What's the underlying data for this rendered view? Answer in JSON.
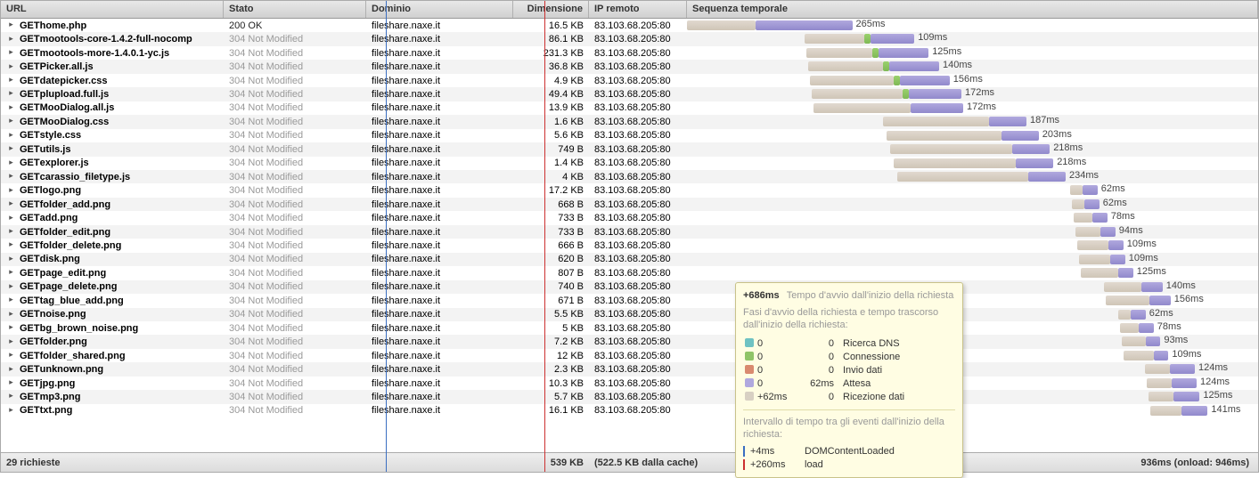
{
  "columns": {
    "url": "URL",
    "stato": "Stato",
    "dominio": "Dominio",
    "dimensione": "Dimensione",
    "ip": "IP remoto",
    "sequenza": "Sequenza temporale"
  },
  "rows": [
    {
      "method": "GET",
      "file": "home.php",
      "stato": "200 OK",
      "statoClass": "",
      "dominio": "fileshare.naxe.it",
      "dim": "16.5 KB",
      "ip": "83.103.68.205:80",
      "start": 0,
      "wait": 110,
      "dns": 0,
      "recv": 155,
      "label": "265ms"
    },
    {
      "method": "GET",
      "file": "mootools-core-1.4.2-full-nocomp",
      "stato": "304 Not Modified",
      "statoClass": "stato-notmod",
      "dominio": "fileshare.naxe.it",
      "dim": "86.1 KB",
      "ip": "83.103.68.205:80",
      "start": 132,
      "wait": 96,
      "dns": 10,
      "recv": 70,
      "label": "109ms"
    },
    {
      "method": "GET",
      "file": "mootools-more-1.4.0.1-yc.js",
      "stato": "304 Not Modified",
      "statoClass": "stato-notmod",
      "dominio": "fileshare.naxe.it",
      "dim": "231.3 KB",
      "ip": "83.103.68.205:80",
      "start": 134,
      "wait": 106,
      "dns": 10,
      "recv": 80,
      "label": "125ms"
    },
    {
      "method": "GET",
      "file": "Picker.all.js",
      "stato": "304 Not Modified",
      "statoClass": "stato-notmod",
      "dominio": "fileshare.naxe.it",
      "dim": "36.8 KB",
      "ip": "83.103.68.205:80",
      "start": 136,
      "wait": 120,
      "dns": 10,
      "recv": 80,
      "label": "140ms"
    },
    {
      "method": "GET",
      "file": "datepicker.css",
      "stato": "304 Not Modified",
      "statoClass": "stato-notmod",
      "dominio": "fileshare.naxe.it",
      "dim": "4.9 KB",
      "ip": "83.103.68.205:80",
      "start": 138,
      "wait": 134,
      "dns": 10,
      "recv": 80,
      "label": "156ms"
    },
    {
      "method": "GET",
      "file": "plupload.full.js",
      "stato": "304 Not Modified",
      "statoClass": "stato-notmod",
      "dominio": "fileshare.naxe.it",
      "dim": "49.4 KB",
      "ip": "83.103.68.205:80",
      "start": 140,
      "wait": 146,
      "dns": 10,
      "recv": 84,
      "label": "172ms"
    },
    {
      "method": "GET",
      "file": "MooDialog.all.js",
      "stato": "304 Not Modified",
      "statoClass": "stato-notmod",
      "dominio": "fileshare.naxe.it",
      "dim": "13.9 KB",
      "ip": "83.103.68.205:80",
      "start": 142,
      "wait": 156,
      "dns": 0,
      "recv": 84,
      "label": "172ms"
    },
    {
      "method": "GET",
      "file": "MooDialog.css",
      "stato": "304 Not Modified",
      "statoClass": "stato-notmod",
      "dominio": "fileshare.naxe.it",
      "dim": "1.6 KB",
      "ip": "83.103.68.205:80",
      "start": 220,
      "wait": 170,
      "dns": 0,
      "recv": 60,
      "label": "187ms"
    },
    {
      "method": "GET",
      "file": "style.css",
      "stato": "304 Not Modified",
      "statoClass": "stato-notmod",
      "dominio": "fileshare.naxe.it",
      "dim": "5.6 KB",
      "ip": "83.103.68.205:80",
      "start": 224,
      "wait": 184,
      "dns": 0,
      "recv": 60,
      "label": "203ms"
    },
    {
      "method": "GET",
      "file": "utils.js",
      "stato": "304 Not Modified",
      "statoClass": "stato-notmod",
      "dominio": "fileshare.naxe.it",
      "dim": "749 B",
      "ip": "83.103.68.205:80",
      "start": 228,
      "wait": 196,
      "dns": 0,
      "recv": 60,
      "label": "218ms"
    },
    {
      "method": "GET",
      "file": "explorer.js",
      "stato": "304 Not Modified",
      "statoClass": "stato-notmod",
      "dominio": "fileshare.naxe.it",
      "dim": "1.4 KB",
      "ip": "83.103.68.205:80",
      "start": 232,
      "wait": 196,
      "dns": 0,
      "recv": 60,
      "label": "218ms"
    },
    {
      "method": "GET",
      "file": "carassio_filetype.js",
      "stato": "304 Not Modified",
      "statoClass": "stato-notmod",
      "dominio": "fileshare.naxe.it",
      "dim": "4 KB",
      "ip": "83.103.68.205:80",
      "start": 236,
      "wait": 210,
      "dns": 0,
      "recv": 60,
      "label": "234ms"
    },
    {
      "method": "GET",
      "file": "logo.png",
      "stato": "304 Not Modified",
      "statoClass": "stato-notmod",
      "dominio": "fileshare.naxe.it",
      "dim": "17.2 KB",
      "ip": "83.103.68.205:80",
      "start": 430,
      "wait": 20,
      "dns": 0,
      "recv": 24,
      "label": "62ms"
    },
    {
      "method": "GET",
      "file": "folder_add.png",
      "stato": "304 Not Modified",
      "statoClass": "stato-notmod",
      "dominio": "fileshare.naxe.it",
      "dim": "668 B",
      "ip": "83.103.68.205:80",
      "start": 432,
      "wait": 20,
      "dns": 0,
      "recv": 24,
      "label": "62ms"
    },
    {
      "method": "GET",
      "file": "add.png",
      "stato": "304 Not Modified",
      "statoClass": "stato-notmod",
      "dominio": "fileshare.naxe.it",
      "dim": "733 B",
      "ip": "83.103.68.205:80",
      "start": 434,
      "wait": 30,
      "dns": 0,
      "recv": 24,
      "label": "78ms"
    },
    {
      "method": "GET",
      "file": "folder_edit.png",
      "stato": "304 Not Modified",
      "statoClass": "stato-notmod",
      "dominio": "fileshare.naxe.it",
      "dim": "733 B",
      "ip": "83.103.68.205:80",
      "start": 436,
      "wait": 40,
      "dns": 0,
      "recv": 24,
      "label": "94ms"
    },
    {
      "method": "GET",
      "file": "folder_delete.png",
      "stato": "304 Not Modified",
      "statoClass": "stato-notmod",
      "dominio": "fileshare.naxe.it",
      "dim": "666 B",
      "ip": "83.103.68.205:80",
      "start": 438,
      "wait": 50,
      "dns": 0,
      "recv": 24,
      "label": "109ms"
    },
    {
      "method": "GET",
      "file": "disk.png",
      "stato": "304 Not Modified",
      "statoClass": "stato-notmod",
      "dominio": "fileshare.naxe.it",
      "dim": "620 B",
      "ip": "83.103.68.205:80",
      "start": 440,
      "wait": 50,
      "dns": 0,
      "recv": 24,
      "label": "109ms"
    },
    {
      "method": "GET",
      "file": "page_edit.png",
      "stato": "304 Not Modified",
      "statoClass": "stato-notmod",
      "dominio": "fileshare.naxe.it",
      "dim": "807 B",
      "ip": "83.103.68.205:80",
      "start": 442,
      "wait": 60,
      "dns": 0,
      "recv": 24,
      "label": "125ms"
    },
    {
      "method": "GET",
      "file": "page_delete.png",
      "stato": "304 Not Modified",
      "statoClass": "stato-notmod",
      "dominio": "fileshare.naxe.it",
      "dim": "740 B",
      "ip": "83.103.68.205:80",
      "start": 468,
      "wait": 60,
      "dns": 0,
      "recv": 34,
      "label": "140ms"
    },
    {
      "method": "GET",
      "file": "tag_blue_add.png",
      "stato": "304 Not Modified",
      "statoClass": "stato-notmod",
      "dominio": "fileshare.naxe.it",
      "dim": "671 B",
      "ip": "83.103.68.205:80",
      "start": 470,
      "wait": 70,
      "dns": 0,
      "recv": 34,
      "label": "156ms"
    },
    {
      "method": "GET",
      "file": "noise.png",
      "stato": "304 Not Modified",
      "statoClass": "stato-notmod",
      "dominio": "fileshare.naxe.it",
      "dim": "5.5 KB",
      "ip": "83.103.68.205:80",
      "start": 484,
      "wait": 20,
      "dns": 0,
      "recv": 24,
      "label": "62ms"
    },
    {
      "method": "GET",
      "file": "bg_brown_noise.png",
      "stato": "304 Not Modified",
      "statoClass": "stato-notmod",
      "dominio": "fileshare.naxe.it",
      "dim": "5 KB",
      "ip": "83.103.68.205:80",
      "start": 486,
      "wait": 30,
      "dns": 0,
      "recv": 24,
      "label": "78ms"
    },
    {
      "method": "GET",
      "file": "folder.png",
      "stato": "304 Not Modified",
      "statoClass": "stato-notmod",
      "dominio": "fileshare.naxe.it",
      "dim": "7.2 KB",
      "ip": "83.103.68.205:80",
      "start": 488,
      "wait": 38,
      "dns": 0,
      "recv": 24,
      "label": "93ms"
    },
    {
      "method": "GET",
      "file": "folder_shared.png",
      "stato": "304 Not Modified",
      "statoClass": "stato-notmod",
      "dominio": "fileshare.naxe.it",
      "dim": "12 KB",
      "ip": "83.103.68.205:80",
      "start": 490,
      "wait": 48,
      "dns": 0,
      "recv": 24,
      "label": "109ms"
    },
    {
      "method": "GET",
      "file": "unknown.png",
      "stato": "304 Not Modified",
      "statoClass": "stato-notmod",
      "dominio": "fileshare.naxe.it",
      "dim": "2.3 KB",
      "ip": "83.103.68.205:80",
      "start": 514,
      "wait": 40,
      "dns": 0,
      "recv": 40,
      "label": "124ms"
    },
    {
      "method": "GET",
      "file": "jpg.png",
      "stato": "304 Not Modified",
      "statoClass": "stato-notmod",
      "dominio": "fileshare.naxe.it",
      "dim": "10.3 KB",
      "ip": "83.103.68.205:80",
      "start": 516,
      "wait": 40,
      "dns": 0,
      "recv": 40,
      "label": "124ms"
    },
    {
      "method": "GET",
      "file": "mp3.png",
      "stato": "304 Not Modified",
      "statoClass": "stato-notmod",
      "dominio": "fileshare.naxe.it",
      "dim": "5.7 KB",
      "ip": "83.103.68.205:80",
      "start": 518,
      "wait": 40,
      "dns": 0,
      "recv": 42,
      "label": "125ms"
    },
    {
      "method": "GET",
      "file": "txt.png",
      "stato": "304 Not Modified",
      "statoClass": "stato-notmod",
      "dominio": "fileshare.naxe.it",
      "dim": "16.1 KB",
      "ip": "83.103.68.205:80",
      "start": 520,
      "wait": 50,
      "dns": 0,
      "recv": 42,
      "label": "141ms"
    }
  ],
  "footer": {
    "requests": "29 richieste",
    "size": "539 KB",
    "cache": "(522.5 KB dalla cache)",
    "summary": "936ms (onload: 946ms)"
  },
  "tooltip": {
    "time": "+686ms",
    "desc": "Tempo d'avvio dall'inizio della richiesta",
    "phases_title": "Fasi d'avvio della richiesta e tempo trascorso dall'inizio della richiesta:",
    "phases": [
      {
        "swatch": "sw-dns",
        "t1": "0",
        "t2": "0",
        "label": "Ricerca DNS"
      },
      {
        "swatch": "sw-conn",
        "t1": "0",
        "t2": "0",
        "label": "Connessione"
      },
      {
        "swatch": "sw-send",
        "t1": "0",
        "t2": "0",
        "label": "Invio dati"
      },
      {
        "swatch": "sw-wait",
        "t1": "0",
        "t2": "62ms",
        "label": "Attesa"
      },
      {
        "swatch": "sw-recv",
        "t1": "+62ms",
        "t2": "0",
        "label": "Ricezione dati"
      }
    ],
    "events_title": "Intervallo di tempo tra gli eventi dall'inizio della richiesta:",
    "events": [
      {
        "mark": "ev-blue",
        "time": "+4ms",
        "label": "DOMContentLoaded"
      },
      {
        "mark": "ev-red",
        "time": "+260ms",
        "label": "load"
      }
    ]
  }
}
